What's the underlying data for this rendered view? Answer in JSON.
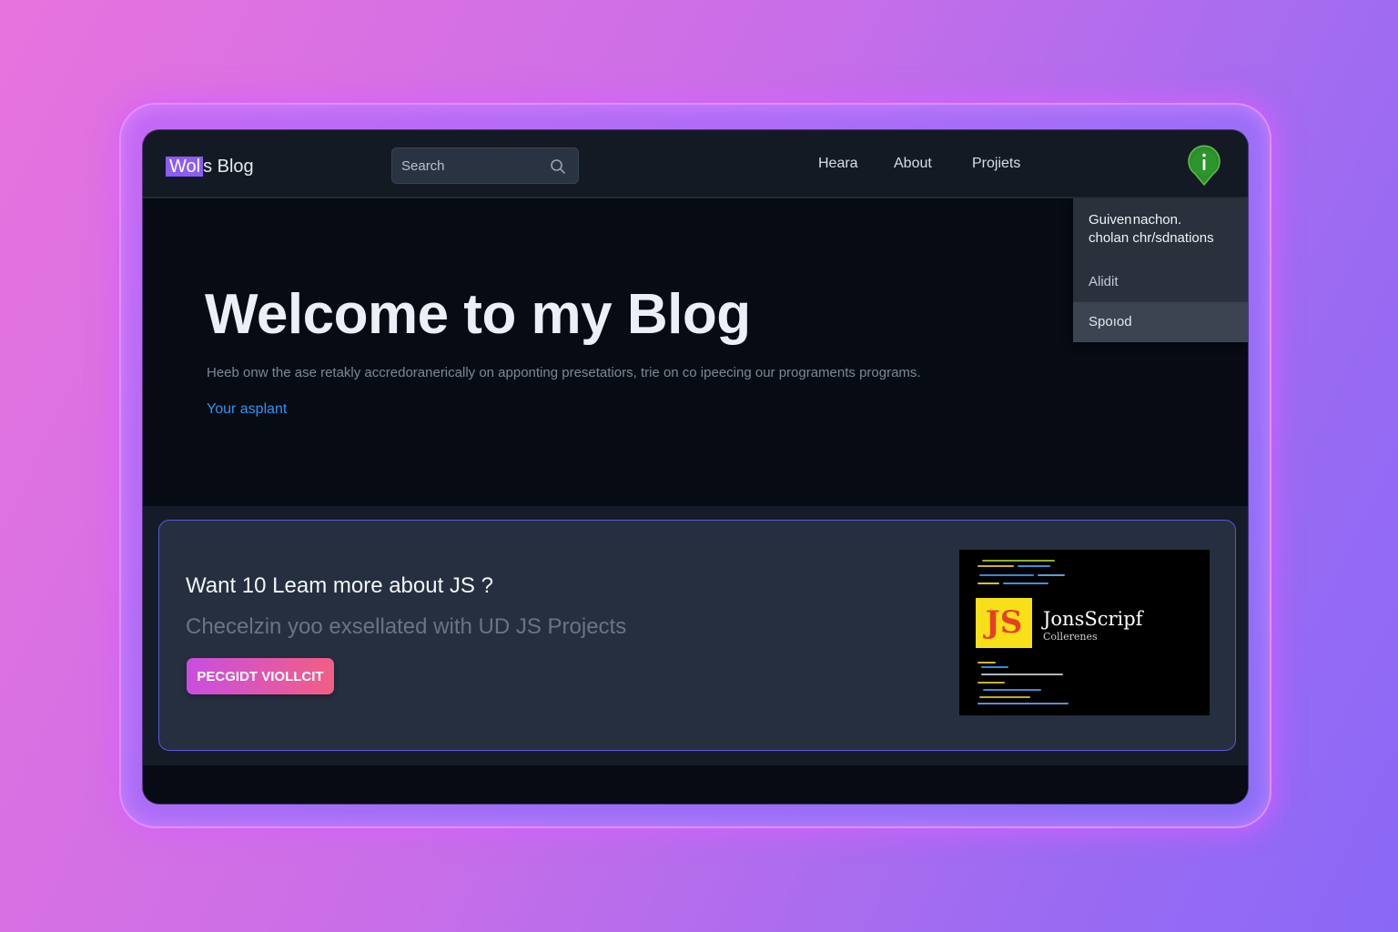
{
  "header": {
    "logo_highlight": "Wol",
    "logo_rest": "s Blog",
    "search_placeholder": "Search",
    "nav": [
      "Heara",
      "About",
      "Projiets"
    ],
    "info_icon": "info-pin-icon"
  },
  "dropdown": {
    "items": [
      "Guiven nachon.",
      "cholan chr/sdnations",
      "Alidit",
      "Spoıod"
    ]
  },
  "hero": {
    "title": "Welcome to my Blog",
    "text": "Heeb onw the ase retakly accredoranerically on apponting presetatiors, trie on co ipeecing our programents programs.",
    "link": "Your asplant"
  },
  "card": {
    "title": "Want 10 Leam more about JS ?",
    "subtitle": "Checelzin yoo exsellated with UD JS Projects",
    "button": "PECGIDT VIOLLCIT",
    "thumb_badge": "JS",
    "thumb_title": "JonsScripf",
    "thumb_subtitle": "Collerenes"
  },
  "colors": {
    "accent_purple": "#8b5cf6",
    "link_blue": "#2f95f2",
    "card_border": "#5a57e0",
    "button_start": "#c94ee0",
    "button_end": "#f25f84",
    "info_green": "#2e8b2e"
  }
}
